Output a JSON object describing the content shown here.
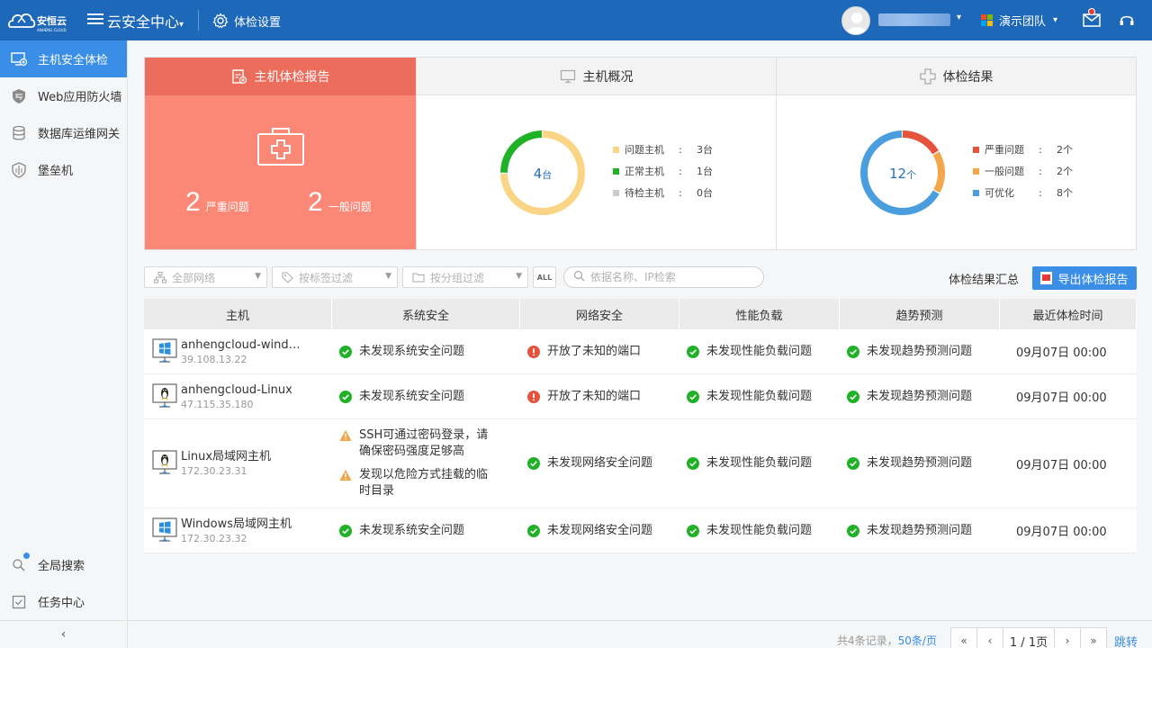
{
  "topbar": {
    "logo_text": "安恒云",
    "logo_sub": "ANHENG CLOUD",
    "app_title": "云安全中心",
    "settings_label": "体检设置",
    "user_name": "···········",
    "team_label": "演示团队"
  },
  "sidebar": {
    "items": [
      {
        "label": "主机安全体检",
        "icon": "monitor-plus-icon"
      },
      {
        "label": "Web应用防火墙",
        "icon": "shield-wall-icon"
      },
      {
        "label": "数据库运维网关",
        "icon": "database-icon"
      },
      {
        "label": "堡垒机",
        "icon": "shield-icon"
      }
    ],
    "bottom_items": [
      {
        "label": "全局搜索",
        "icon": "search-icon"
      },
      {
        "label": "任务中心",
        "icon": "task-icon"
      }
    ],
    "collapse_glyph": "‹"
  },
  "report": {
    "title": "主机体检报告",
    "severe_count": "2",
    "severe_label": "严重问题",
    "general_count": "2",
    "general_label": "一般问题"
  },
  "overview": {
    "title": "主机概况",
    "center_value": "4",
    "center_unit": "台",
    "legend": [
      {
        "name": "问题主机",
        "value": "3台",
        "color": "#fad585"
      },
      {
        "name": "正常主机",
        "value": "1台",
        "color": "#21b127"
      },
      {
        "name": "待检主机",
        "value": "0台",
        "color": "#cccccc"
      }
    ]
  },
  "results": {
    "title": "体检结果",
    "center_value": "12",
    "center_unit": "个",
    "legend": [
      {
        "name": "严重问题",
        "value": "2个",
        "color": "#e5533d"
      },
      {
        "name": "一般问题",
        "value": "2个",
        "color": "#f2a74b"
      },
      {
        "name": "可优化",
        "value": "8个",
        "color": "#4a9ede"
      }
    ]
  },
  "chart_data": [
    {
      "type": "pie",
      "categories": [
        "问题主机",
        "正常主机",
        "待检主机"
      ],
      "values": [
        3,
        1,
        0
      ],
      "title": "主机概况"
    },
    {
      "type": "pie",
      "categories": [
        "严重问题",
        "一般问题",
        "可优化"
      ],
      "values": [
        2,
        2,
        8
      ],
      "title": "体检结果"
    }
  ],
  "filters": {
    "network": "全部网络",
    "tag": "按标签过滤",
    "group": "按分组过滤",
    "all": "ALL",
    "search_placeholder": "依据名称、IP检索",
    "summary_label": "体检结果汇总",
    "export_label": "导出体检报告"
  },
  "table": {
    "columns": [
      "主机",
      "系统安全",
      "网络安全",
      "性能负载",
      "趋势预测",
      "最近体检时间"
    ],
    "rows": [
      {
        "os": "windows",
        "host": "anhengcloud-wind…",
        "ip": "39.108.13.22",
        "system": [
          {
            "state": "ok",
            "text": "未发现系统安全问题"
          }
        ],
        "network": {
          "state": "error",
          "text": "开放了未知的端口"
        },
        "performance": {
          "state": "ok",
          "text": "未发现性能负载问题"
        },
        "trend": {
          "state": "ok",
          "text": "未发现趋势预测问题"
        },
        "time": "09月07日 00:00"
      },
      {
        "os": "linux",
        "host": "anhengcloud-Linux",
        "ip": "47.115.35.180",
        "system": [
          {
            "state": "ok",
            "text": "未发现系统安全问题"
          }
        ],
        "network": {
          "state": "error",
          "text": "开放了未知的端口"
        },
        "performance": {
          "state": "ok",
          "text": "未发现性能负载问题"
        },
        "trend": {
          "state": "ok",
          "text": "未发现趋势预测问题"
        },
        "time": "09月07日 00:00"
      },
      {
        "os": "linux",
        "host": "Linux局域网主机",
        "ip": "172.30.23.31",
        "system": [
          {
            "state": "warn",
            "text": "SSH可通过密码登录，请确保密码强度足够高"
          },
          {
            "state": "warn",
            "text": "发现以危险方式挂载的临时目录"
          }
        ],
        "network": {
          "state": "ok",
          "text": "未发现网络安全问题"
        },
        "performance": {
          "state": "ok",
          "text": "未发现性能负载问题"
        },
        "trend": {
          "state": "ok",
          "text": "未发现趋势预测问题"
        },
        "time": "09月07日 00:00"
      },
      {
        "os": "windows",
        "host": "Windows局域网主机",
        "ip": "172.30.23.32",
        "system": [
          {
            "state": "ok",
            "text": "未发现系统安全问题"
          }
        ],
        "network": {
          "state": "ok",
          "text": "未发现网络安全问题"
        },
        "performance": {
          "state": "ok",
          "text": "未发现性能负载问题"
        },
        "trend": {
          "state": "ok",
          "text": "未发现趋势预测问题"
        },
        "time": "09月07日 00:00"
      }
    ]
  },
  "pager": {
    "total_text": "共4条记录，",
    "page_size": "50条/页",
    "first": "«",
    "prev": "‹",
    "current": "1 / 1页",
    "next": "›",
    "last": "»",
    "jump_label": "跳转"
  },
  "colors": {
    "brand": "#1d68b9",
    "accent": "#3a8ee6",
    "report_bg": "#fb8876",
    "report_head": "#ed6d5d",
    "ok": "#21b127",
    "error": "#e5533d",
    "warn": "#f2a74b"
  }
}
